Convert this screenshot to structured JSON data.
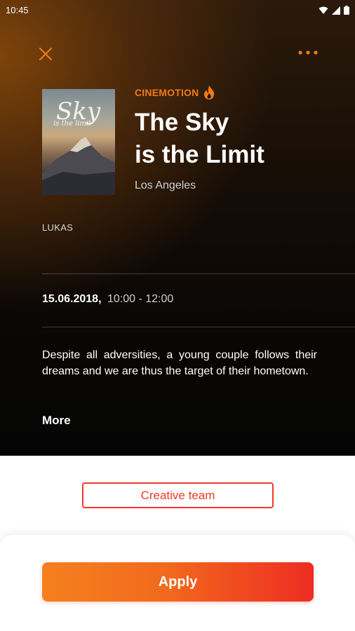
{
  "status_bar": {
    "time": "10:45"
  },
  "header": {
    "brand": "CINEMOTION"
  },
  "event": {
    "title_line1": "The Sky",
    "title_line2": "is the Limit",
    "location": "Los Angeles",
    "author": "LUKAS",
    "date": "15.06.2018,",
    "hours": "10:00 - 12:00",
    "description": "Despite all adversities, a young couple follows their dreams and we are thus the target of their hometown.",
    "more_label": "More"
  },
  "poster": {
    "title_text": "Sky",
    "subtitle_text": "is the limit"
  },
  "actions": {
    "creative_team_label": "Creative team",
    "apply_label": "Apply"
  },
  "colors": {
    "accent_orange": "#f07a14",
    "accent_red": "#ee3a28"
  },
  "icons": [
    "close-icon",
    "more-dots-icon",
    "flame-icon",
    "wifi-icon",
    "signal-icon",
    "battery-icon"
  ]
}
